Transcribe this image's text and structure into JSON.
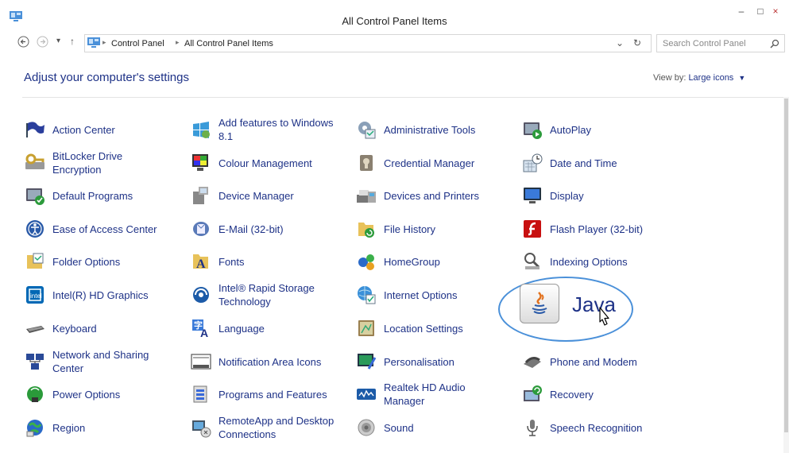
{
  "window": {
    "title": "All Control Panel Items",
    "minimize": "–",
    "maximize": "□",
    "close": "×"
  },
  "nav": {
    "back": "←",
    "forward": "→",
    "recent": "▾",
    "up": "↑"
  },
  "address": {
    "breadcrumbs": [
      "Control Panel",
      "All Control Panel Items"
    ],
    "dropdown": "⌄",
    "refresh": "↻"
  },
  "search": {
    "placeholder": "Search Control Panel"
  },
  "header": {
    "title": "Adjust your computer's settings",
    "view_by_label": "View by:",
    "view_by_value": "Large icons"
  },
  "items": [
    {
      "label": "Action Center",
      "icon": "flag-icon"
    },
    {
      "label": "Add features to Windows 8.1",
      "icon": "add-features-icon"
    },
    {
      "label": "Administrative Tools",
      "icon": "admin-tools-icon"
    },
    {
      "label": "AutoPlay",
      "icon": "autoplay-icon"
    },
    {
      "label": "BitLocker Drive Encryption",
      "icon": "bitlocker-icon"
    },
    {
      "label": "Colour Management",
      "icon": "colour-icon"
    },
    {
      "label": "Credential Manager",
      "icon": "credential-icon"
    },
    {
      "label": "Date and Time",
      "icon": "clock-icon"
    },
    {
      "label": "Default Programs",
      "icon": "default-programs-icon"
    },
    {
      "label": "Device Manager",
      "icon": "device-manager-icon"
    },
    {
      "label": "Devices and Printers",
      "icon": "printer-icon"
    },
    {
      "label": "Display",
      "icon": "display-icon"
    },
    {
      "label": "Ease of Access Center",
      "icon": "ease-access-icon"
    },
    {
      "label": "E-Mail (32-bit)",
      "icon": "email-icon"
    },
    {
      "label": "File History",
      "icon": "file-history-icon"
    },
    {
      "label": "Flash Player (32-bit)",
      "icon": "flash-icon"
    },
    {
      "label": "Folder Options",
      "icon": "folder-options-icon"
    },
    {
      "label": "Fonts",
      "icon": "fonts-icon"
    },
    {
      "label": "HomeGroup",
      "icon": "homegroup-icon"
    },
    {
      "label": "Indexing Options",
      "icon": "indexing-icon"
    },
    {
      "label": "Intel(R) HD Graphics",
      "icon": "intel-graphics-icon"
    },
    {
      "label": "Intel® Rapid Storage Technology",
      "icon": "intel-storage-icon"
    },
    {
      "label": "Internet Options",
      "icon": "internet-options-icon"
    },
    {
      "label": "Java",
      "icon": "java-icon"
    },
    {
      "label": "Keyboard",
      "icon": "keyboard-icon"
    },
    {
      "label": "Language",
      "icon": "language-icon"
    },
    {
      "label": "Location Settings",
      "icon": "location-icon"
    },
    {
      "label": "",
      "icon": ""
    },
    {
      "label": "Network and Sharing Center",
      "icon": "network-icon"
    },
    {
      "label": "Notification Area Icons",
      "icon": "notification-icon"
    },
    {
      "label": "Personalisation",
      "icon": "personalisation-icon"
    },
    {
      "label": "Phone and Modem",
      "icon": "phone-icon"
    },
    {
      "label": "Power Options",
      "icon": "power-icon"
    },
    {
      "label": "Programs and Features",
      "icon": "programs-icon"
    },
    {
      "label": "Realtek HD Audio Manager",
      "icon": "audio-icon"
    },
    {
      "label": "Recovery",
      "icon": "recovery-icon"
    },
    {
      "label": "Region",
      "icon": "region-icon"
    },
    {
      "label": "RemoteApp and Desktop Connections",
      "icon": "remoteapp-icon"
    },
    {
      "label": "Sound",
      "icon": "sound-icon"
    },
    {
      "label": "Speech Recognition",
      "icon": "microphone-icon"
    }
  ],
  "colors": {
    "link": "#1e3287",
    "highlight": "#4a90d9"
  }
}
